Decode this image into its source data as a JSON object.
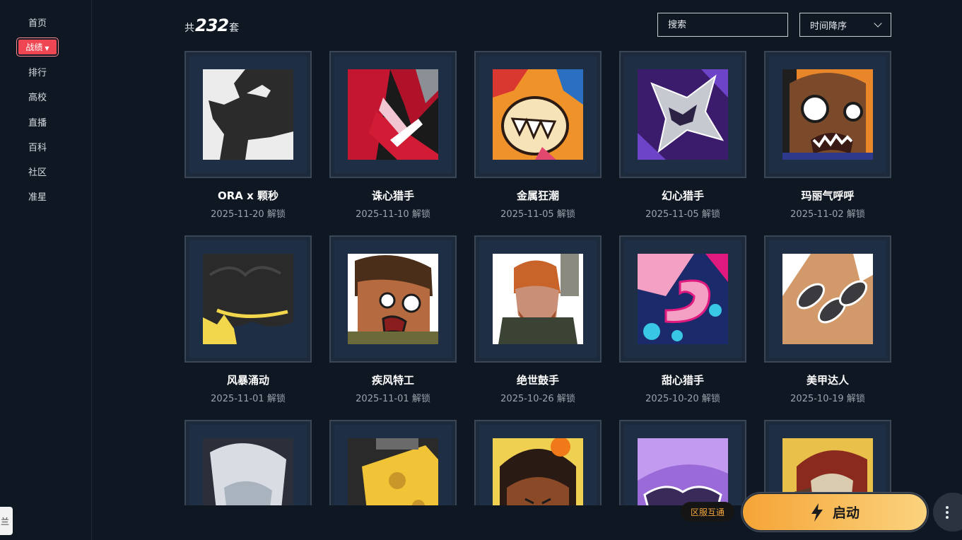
{
  "sidebar": {
    "items": [
      {
        "label": "首页"
      },
      {
        "label": "战绩",
        "active": true
      },
      {
        "label": "排行"
      },
      {
        "label": "高校"
      },
      {
        "label": "直播"
      },
      {
        "label": "百科"
      },
      {
        "label": "社区"
      },
      {
        "label": "准星"
      }
    ],
    "side_tab": "兰"
  },
  "header": {
    "count_prefix": "共",
    "count_value": "232",
    "count_suffix": "套",
    "search_placeholder": "搜索",
    "sort_label": "时间降序"
  },
  "cards": [
    {
      "name": "ORA x 颗秒",
      "date": "2025-11-20 解锁",
      "icon": "rhino-emblem"
    },
    {
      "name": "诛心猎手",
      "date": "2025-11-10 解锁",
      "icon": "red-chevron-shards"
    },
    {
      "name": "金属狂潮",
      "date": "2025-11-05 解锁",
      "icon": "toothy-monster"
    },
    {
      "name": "幻心猎手",
      "date": "2025-11-05 解锁",
      "icon": "silver-star-heart"
    },
    {
      "name": "玛丽气呼呼",
      "date": "2025-11-02 解锁",
      "icon": "angry-face"
    },
    {
      "name": "风暴涌动",
      "date": "2025-11-01 解锁",
      "icon": "storm-crown"
    },
    {
      "name": "疾风特工",
      "date": "2025-11-01 解锁",
      "icon": "shouting-agent"
    },
    {
      "name": "绝世鼓手",
      "date": "2025-10-26 解锁",
      "icon": "bearded-drummer"
    },
    {
      "name": "甜心猎手",
      "date": "2025-10-20 解锁",
      "icon": "candy-swirl"
    },
    {
      "name": "美甲达人",
      "date": "2025-10-19 解锁",
      "icon": "claw-nails"
    },
    {
      "name": "",
      "date": "",
      "icon": "silver-hair-girl"
    },
    {
      "name": "",
      "date": "",
      "icon": "cheese-block"
    },
    {
      "name": "",
      "date": "",
      "icon": "grumpy-kid"
    },
    {
      "name": "",
      "date": "",
      "icon": "purple-glasses"
    },
    {
      "name": "",
      "date": "",
      "icon": "horned-warrior"
    }
  ],
  "footer": {
    "region_label": "区服互通",
    "launch_label": "启动"
  },
  "colors": {
    "background": "#0f1822",
    "active_pill": "#ef4654",
    "launch_start": "#f5a436",
    "launch_end": "#fbd37e",
    "region_text": "#f4a53a"
  }
}
